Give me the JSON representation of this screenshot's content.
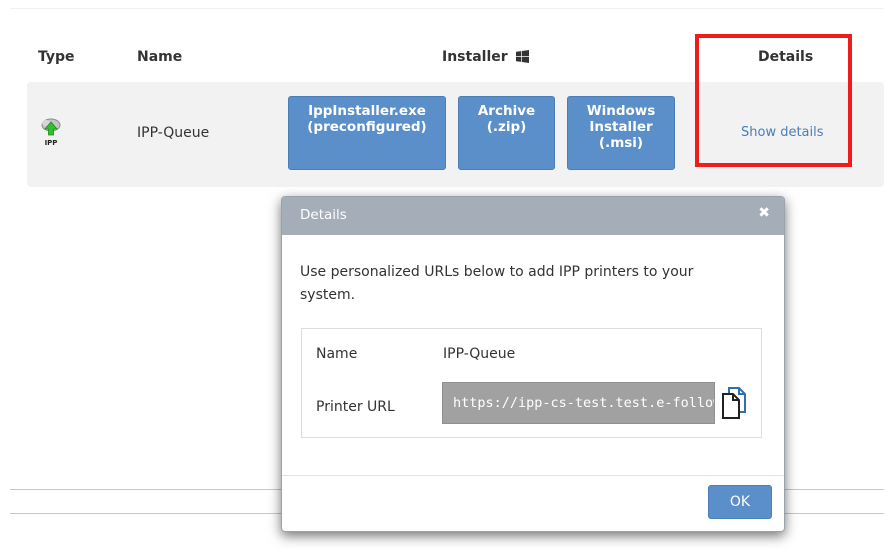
{
  "table": {
    "headers": {
      "type": "Type",
      "name": "Name",
      "installer": "Installer",
      "details": "Details"
    },
    "rows": [
      {
        "type_icon": "ipp-printer-icon",
        "type_icon_label": "IPP",
        "name": "IPP-Queue",
        "installers": [
          "IppInstaller.exe\n(preconfigured)",
          "Archive\n(.zip)",
          "Windows\nInstaller\n(.msi)"
        ],
        "details_link": "Show details"
      }
    ]
  },
  "highlight": {
    "target": "Details",
    "color": "#ee1c1c"
  },
  "modal": {
    "title": "Details",
    "close_icon": "close-icon",
    "intro": "Use personalized URLs below to add IPP printers to your system.",
    "name_label": "Name",
    "name_value": "IPP-Queue",
    "url_label": "Printer URL",
    "url_value": "https://ipp-cs-test.test.e-follow.",
    "copy_icon": "copy-icon",
    "ok_label": "OK"
  },
  "colors": {
    "accent": "#5b8fc9",
    "link": "#4a7db9",
    "modal_header": "#a4adb8",
    "row_background": "#f2f2f2"
  }
}
